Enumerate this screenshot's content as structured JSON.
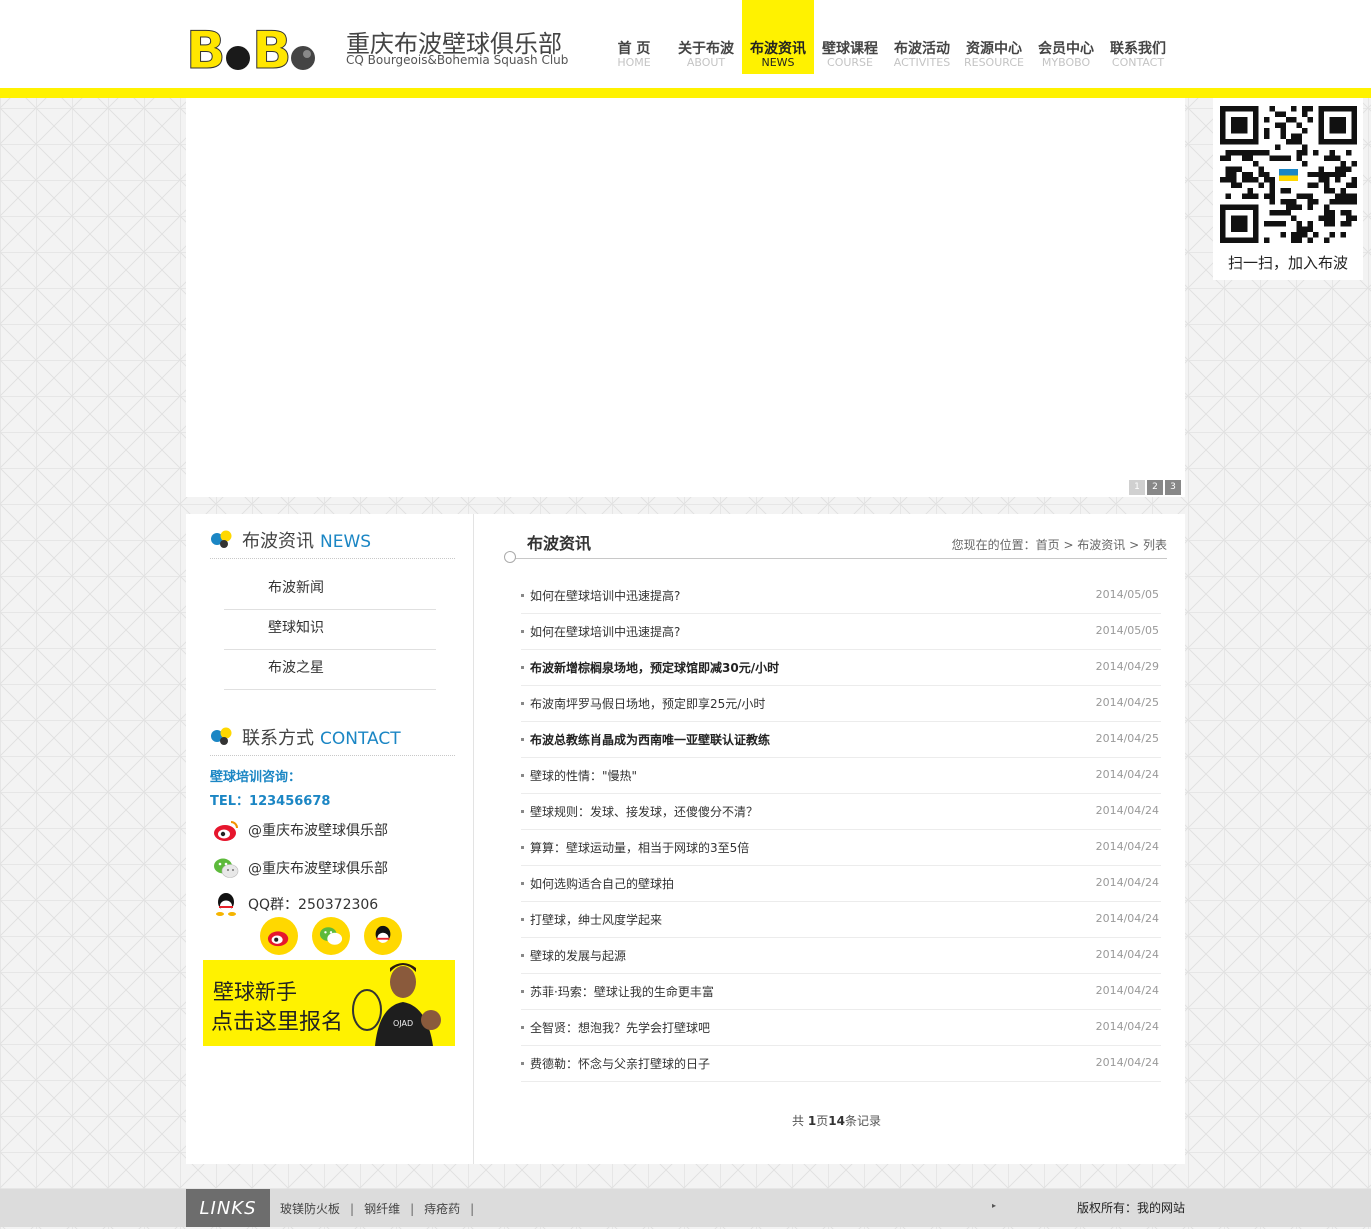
{
  "header": {
    "logo_mark": "BoBo",
    "logo_cn": "重庆布波壁球俱乐部",
    "logo_en": "CQ Bourgeois&Bohemia Squash Club",
    "nav": [
      {
        "cn": "首 页",
        "en": "HOME",
        "active": false
      },
      {
        "cn": "关于布波",
        "en": "ABOUT",
        "active": false
      },
      {
        "cn": "布波资讯",
        "en": "NEWS",
        "active": true
      },
      {
        "cn": "壁球课程",
        "en": "COURSE",
        "active": false
      },
      {
        "cn": "布波活动",
        "en": "ACTIVITES",
        "active": false
      },
      {
        "cn": "资源中心",
        "en": "RESOURCE",
        "active": false
      },
      {
        "cn": "会员中心",
        "en": "MYBOBO",
        "active": false
      },
      {
        "cn": "联系我们",
        "en": "CONTACT",
        "active": false
      }
    ],
    "accent_color": "#fff200"
  },
  "banner": {
    "pager": [
      "1",
      "2",
      "3"
    ],
    "active_page": 1
  },
  "qr": {
    "caption": "扫一扫，加入布波"
  },
  "sidebar": {
    "news_heading_cn": "布波资讯",
    "news_heading_en": "NEWS",
    "menu": [
      "布波新闻",
      "壁球知识",
      "布波之星"
    ],
    "contact_heading_cn": "联系方式",
    "contact_heading_en": "CONTACT",
    "consult_label": "壁球培训咨询：",
    "tel": "TEL：123456678",
    "weibo": "@重庆布波壁球俱乐部",
    "wechat": "@重庆布波壁球俱乐部",
    "qq_group": "QQ群：250372306",
    "signup_line1": "壁球新手",
    "signup_line2": "点击这里报名"
  },
  "main": {
    "title": "布波资讯",
    "breadcrumb": "您现在的位置：首页 > 布波资讯 > 列表",
    "news": [
      {
        "title": "如何在壁球培训中迅速提高?",
        "date": "2014/05/05",
        "bold": false
      },
      {
        "title": "如何在壁球培训中迅速提高?",
        "date": "2014/05/05",
        "bold": false
      },
      {
        "title": "布波新增棕榈泉场地，预定球馆即减30元/小时",
        "date": "2014/04/29",
        "bold": true
      },
      {
        "title": "布波南坪罗马假日场地，预定即享25元/小时",
        "date": "2014/04/25",
        "bold": false
      },
      {
        "title": "布波总教练肖晶成为西南唯一亚壁联认证教练",
        "date": "2014/04/25",
        "bold": true
      },
      {
        "title": "壁球的性情：\"慢热\"",
        "date": "2014/04/24",
        "bold": false
      },
      {
        "title": "壁球规则：发球、接发球，还傻傻分不清？",
        "date": "2014/04/24",
        "bold": false
      },
      {
        "title": "算算：壁球运动量，相当于网球的3至5倍",
        "date": "2014/04/24",
        "bold": false
      },
      {
        "title": "如何选购适合自己的壁球拍",
        "date": "2014/04/24",
        "bold": false
      },
      {
        "title": "打壁球，绅士风度学起来",
        "date": "2014/04/24",
        "bold": false
      },
      {
        "title": "壁球的发展与起源",
        "date": "2014/04/24",
        "bold": false
      },
      {
        "title": "苏菲·玛索：壁球让我的生命更丰富",
        "date": "2014/04/24",
        "bold": false
      },
      {
        "title": "全智贤：想泡我？先学会打壁球吧",
        "date": "2014/04/24",
        "bold": false
      },
      {
        "title": "费德勒：怀念与父亲打壁球的日子",
        "date": "2014/04/24",
        "bold": false
      }
    ],
    "pagination_prefix": "共",
    "pagination_pages": "1",
    "pagination_mid": "页",
    "pagination_count": "14",
    "pagination_suffix": "条记录"
  },
  "footer": {
    "links_label": "LINKS",
    "links": [
      "玻镁防火板",
      "钢纤维",
      "痔疮药"
    ],
    "arrow": "▸",
    "copyright_label": "版权所有：",
    "copyright_value": "我的网站"
  }
}
